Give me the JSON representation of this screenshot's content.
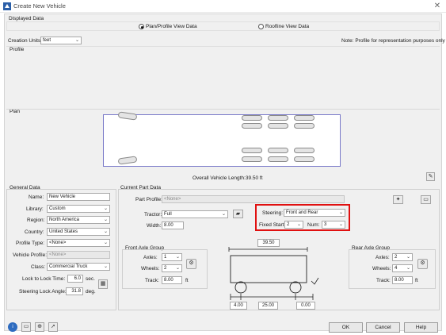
{
  "window": {
    "title": "Create New Vehicle",
    "close_glyph": "✕"
  },
  "displayed_data": {
    "label": "Displayed Data",
    "options": [
      "Plan/Profile View Data",
      "Roofline View Data"
    ],
    "selected": "Plan/Profile View Data"
  },
  "creation_units": {
    "label": "Creation Units:",
    "value": "feet"
  },
  "note": "Note: Profile for representation purposes only",
  "profile_label": "Profile",
  "plan_label": "Plan",
  "overall_length": "Overall Vehicle Length:39.50 ft",
  "general_data": {
    "label": "General Data",
    "name_label": "Name:",
    "name_value": "New Vehicle",
    "library_label": "Library:",
    "library_value": "Custom",
    "region_label": "Region:",
    "region_value": "North America",
    "country_label": "Country:",
    "country_value": "United States",
    "profile_type_label": "Profile Type:",
    "profile_type_value": "<None>",
    "vehicle_profile_label": "Vehicle Profile:",
    "vehicle_profile_value": "<None>",
    "class_label": "Class:",
    "class_value": "Commercial Truck",
    "lock_time_label": "Lock to Lock Time:",
    "lock_time_value": "6.0",
    "lock_time_unit": "sec.",
    "steering_angle_label": "Steering Lock Angle:",
    "steering_angle_value": "31.8",
    "steering_angle_unit": "deg."
  },
  "current_part": {
    "label": "Current Part Data",
    "part_profile_label": "Part Profile:",
    "part_profile_value": "<None>",
    "tractor_label": "Tractor:",
    "tractor_value": "Full",
    "width_label": "Width:",
    "width_value": "8.00",
    "steering_label": "Steering:",
    "steering_value": "Front and Rear",
    "fixed_start_label": "Fixed Start:",
    "fixed_start_value": "2",
    "num_label": "Num:",
    "num_value": "3"
  },
  "front_axle": {
    "label": "Front Axle Group",
    "axles_label": "Axles:",
    "axles_value": "1",
    "wheels_label": "Wheels:",
    "wheels_value": "2",
    "track_label": "Track:",
    "track_value": "8.00",
    "track_unit": "ft"
  },
  "rear_axle": {
    "label": "Rear Axle Group",
    "axles_label": "Axles:",
    "axles_value": "2",
    "wheels_label": "Wheels:",
    "wheels_value": "4",
    "track_label": "Track:",
    "track_value": "8.00",
    "track_unit": "ft"
  },
  "diagram": {
    "length": "39.50",
    "front_overhang": "4.00",
    "wheelbase": "25.00",
    "rear_overhang": "0.00"
  },
  "buttons": {
    "ok": "OK",
    "cancel": "Cancel",
    "help": "Help"
  },
  "colors": {
    "highlight": "#e01010",
    "vehicle_outline": "#7878c8"
  }
}
